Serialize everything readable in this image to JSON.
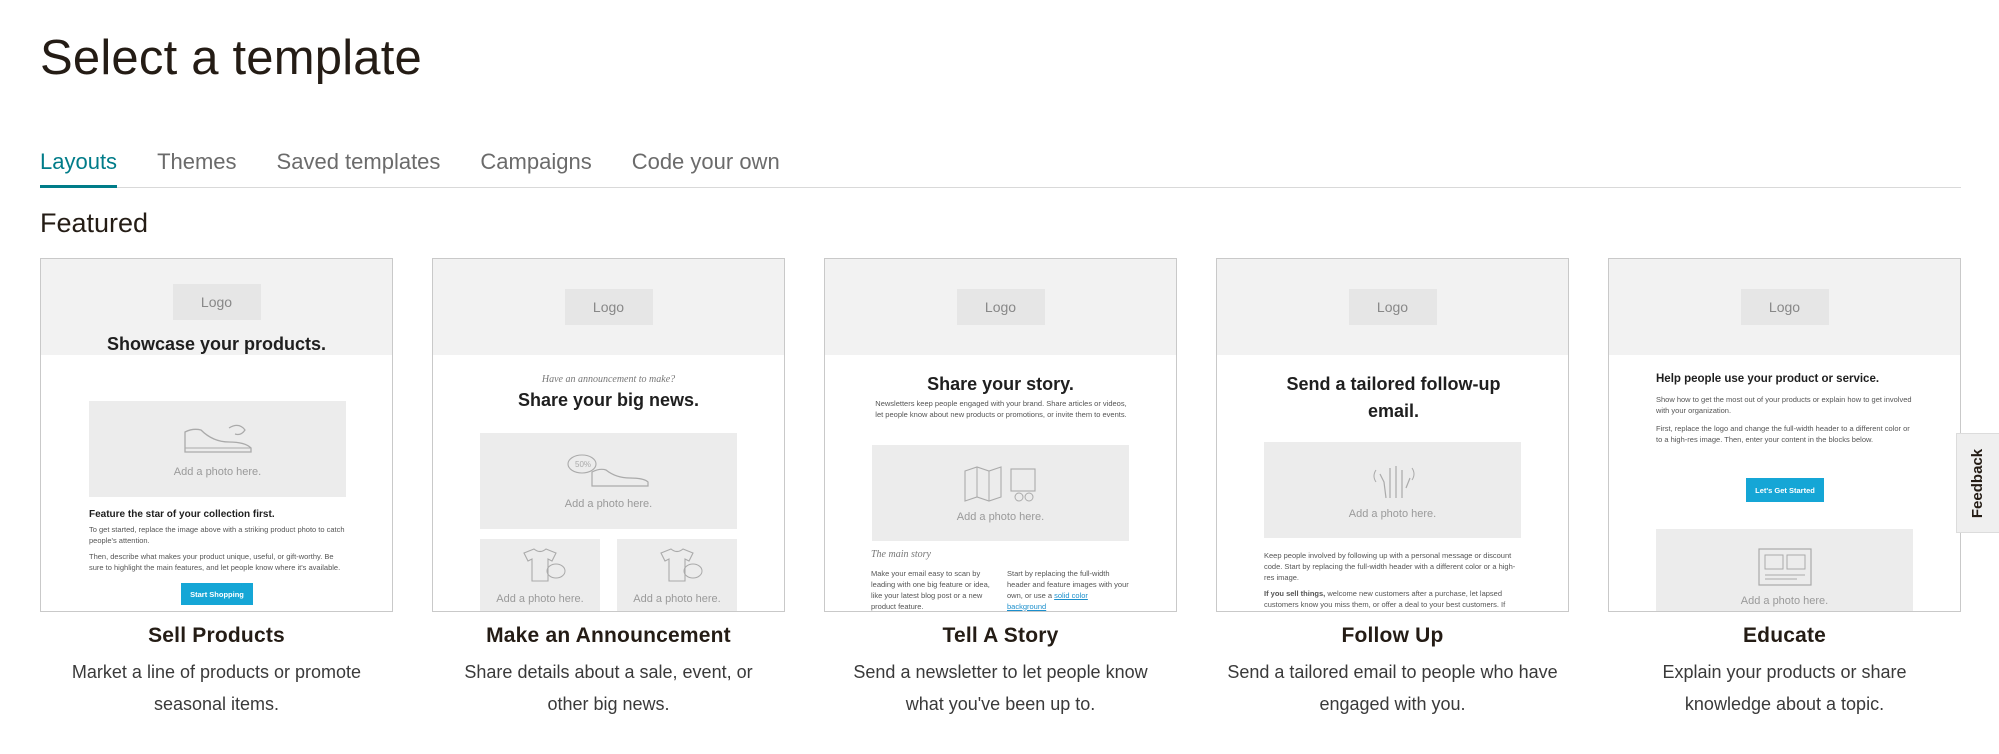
{
  "page": {
    "title": "Select a template",
    "section": "Featured"
  },
  "tabs": [
    {
      "label": "Layouts",
      "active": true
    },
    {
      "label": "Themes"
    },
    {
      "label": "Saved templates"
    },
    {
      "label": "Campaigns"
    },
    {
      "label": "Code your own"
    }
  ],
  "colors": {
    "accent": "#007c89",
    "cta": "#15a6d6",
    "text": "#241c15"
  },
  "cards": [
    {
      "title": "Sell Products",
      "description": "Market a line of products or promote seasonal items.",
      "preview": {
        "logo": "Logo",
        "headline": "Showcase your products.",
        "photo_label": "Add a photo here.",
        "icon": "shoe-icon",
        "subhead": "Feature the star of your collection first.",
        "para1": "To get started, replace the image above with a striking product photo to catch people's attention.",
        "para2": "Then, describe what makes your product unique, useful, or gift-worthy. Be sure to highlight the main features, and let people know where it's available.",
        "button": "Start Shopping"
      }
    },
    {
      "title": "Make an Announcement",
      "description": "Share details about a sale, event, or other big news.",
      "preview": {
        "logo": "Logo",
        "kicker": "Have an announcement to make?",
        "headline": "Share your big news.",
        "photo_label": "Add a photo here.",
        "photo_label_2": "Add a photo here.",
        "photo_label_3": "Add a photo here.",
        "icon": "shoe-sale-icon",
        "icon_2": "shirt-sale-icon",
        "badge": "50%"
      }
    },
    {
      "title": "Tell A Story",
      "description": "Send a newsletter to let people know what you've been up to.",
      "preview": {
        "logo": "Logo",
        "headline": "Share your story.",
        "intro": "Newsletters keep people engaged with your brand. Share articles or videos, let people know about new products or promotions, or invite them to events.",
        "photo_label": "Add a photo here.",
        "icon": "map-icon",
        "kicker": "The main story",
        "col1": "Make your email easy to scan by leading with one big feature or idea, like your latest blog post or a new product feature.",
        "col2": "Start by replacing the full-width header and feature images with your own, or use a",
        "col2_link": "solid color background"
      }
    },
    {
      "title": "Follow Up",
      "description": "Send a tailored email to people who have engaged with you.",
      "preview": {
        "logo": "Logo",
        "headline": "Send a tailored follow-up email.",
        "photo_label": "Add a photo here.",
        "icon": "hand-wave-icon",
        "para1": "Keep people involved by following up with a personal message or discount code. Start by replacing the full-width header with a different color or a high-res image.",
        "para2_bold": "If you sell things,",
        "para2": "welcome new customers after a purchase, let lapsed customers know you miss them, or offer a deal to your best customers. If"
      }
    },
    {
      "title": "Educate",
      "description": "Explain your products or share knowledge about a topic.",
      "preview": {
        "logo": "Logo",
        "headline": "Help people use your product or service.",
        "para1": "Show how to get the most out of your products or explain how to get involved with your organization.",
        "para2": "First, replace the logo and change the full-width header to a different color or to a high-res image. Then, enter your content in the blocks below.",
        "button": "Let's Get Started",
        "photo_label": "Add a photo here.",
        "icon": "layout-icon"
      }
    }
  ],
  "feedback": {
    "label": "Feedback"
  }
}
